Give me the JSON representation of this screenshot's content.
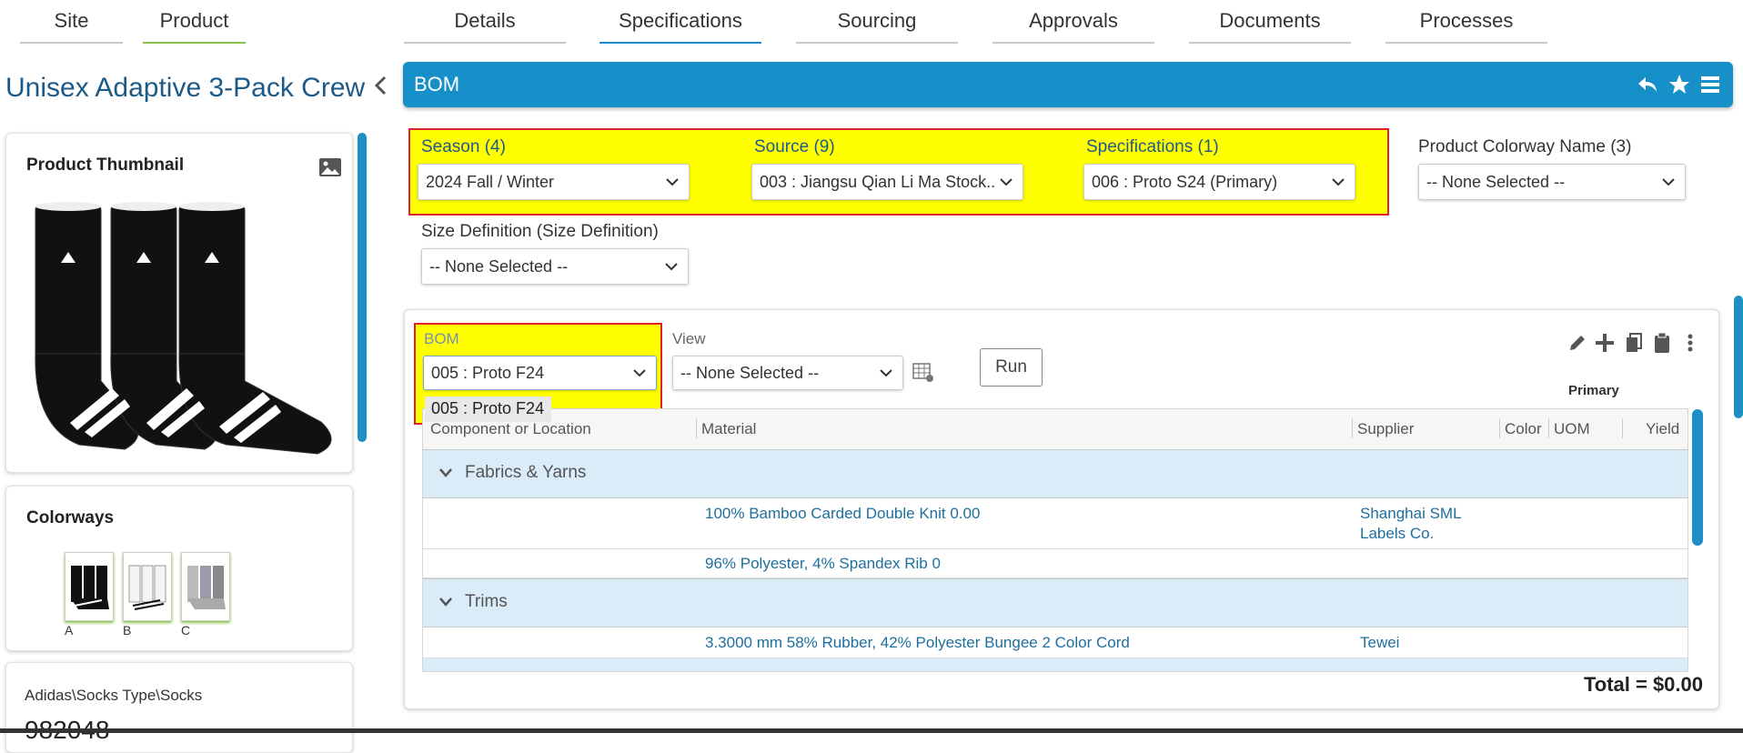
{
  "top_tabs": {
    "site": "Site",
    "product": "Product",
    "details": "Details",
    "specifications": "Specifications",
    "sourcing": "Sourcing",
    "approvals": "Approvals",
    "documents": "Documents",
    "processes": "Processes"
  },
  "product": {
    "title": "Unisex Adaptive 3-Pack Crew",
    "thumbnail_title": "Product Thumbnail",
    "colorways_title": "Colorways",
    "colorways": [
      "A",
      "B",
      "C"
    ],
    "category_path": "Adidas\\Socks Type\\Socks",
    "number_partial": "982048"
  },
  "bom_bar": {
    "title": "BOM"
  },
  "filters": {
    "season_label": "Season (4)",
    "season_value": "2024 Fall / Winter",
    "source_label": "Source (9)",
    "source_value": "003 : Jiangsu Qian Li Ma Stock...",
    "spec_label": "Specifications (1)",
    "spec_value": "006 : Proto S24 (Primary)",
    "colorway_label": "Product Colorway Name (3)",
    "colorway_value": "-- None Selected --",
    "size_label": "Size Definition (Size Definition)",
    "size_value": "-- None Selected --"
  },
  "bom_panel": {
    "bom_label": "BOM",
    "bom_value": "005 : Proto F24",
    "bom_option": "005 : Proto F24",
    "view_label": "View",
    "view_value": "-- None Selected --",
    "run_label": "Run",
    "primary_label": "Primary"
  },
  "table": {
    "headers": {
      "component": "Component or Location",
      "material": "Material",
      "supplier": "Supplier",
      "color": "Color",
      "uom": "UOM",
      "yield": "Yield"
    },
    "groups": [
      {
        "name": "Fabrics & Yarns",
        "rows": [
          {
            "material": "100% Bamboo Carded Double Knit 0.00",
            "supplier_line1": "Shanghai SML",
            "supplier_line2": "Labels Co."
          },
          {
            "material": "96% Polyester, 4% Spandex Rib 0",
            "supplier_line1": "",
            "supplier_line2": ""
          }
        ]
      },
      {
        "name": "Trims",
        "rows": [
          {
            "material": "3.3000 mm 58% Rubber, 42% Polyester Bungee 2 Color Cord",
            "supplier_line1": "Tewei",
            "supplier_line2": ""
          }
        ]
      }
    ]
  },
  "total": "Total = $0.00",
  "colors": {
    "accent_blue": "#1790c9",
    "highlight_yellow": "#ffff00",
    "highlight_red": "#e0202a",
    "link_blue": "#1d6f9e",
    "group_row_bg": "#d9ecf8",
    "green_tab": "#8bc34a"
  },
  "icons": [
    "chevron-left-icon",
    "image-icon",
    "reply-icon",
    "star-icon",
    "menu-icon",
    "chevron-down-icon",
    "table-settings-icon",
    "edit-icon",
    "plus-icon",
    "copy-icon",
    "clipboard-icon",
    "more-vertical-icon"
  ]
}
